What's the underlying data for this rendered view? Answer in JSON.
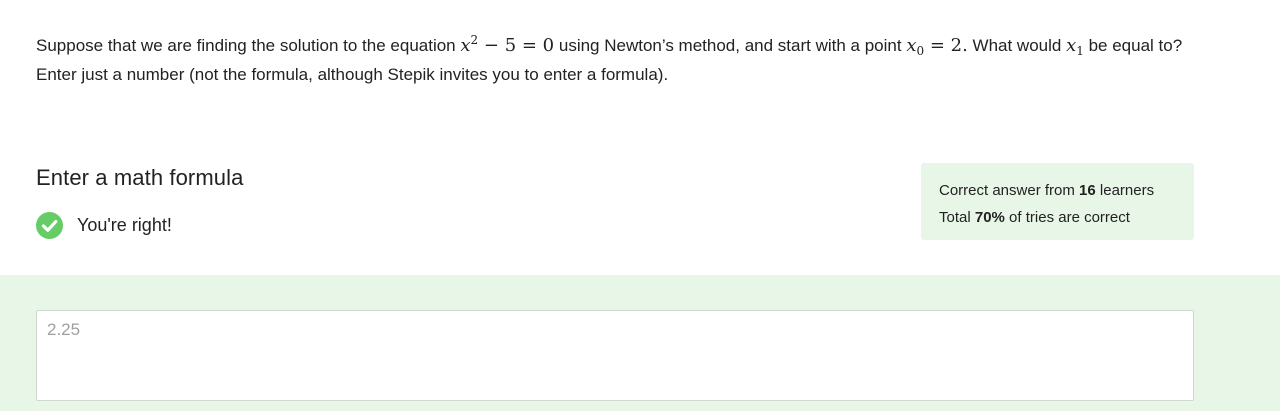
{
  "question": {
    "part1": "Suppose that we are finding the solution to the equation ",
    "eq_var": "x",
    "eq_exp": "2",
    "eq_rest": " − 5 = 0",
    "part2": " using Newton’s method, and start with a point ",
    "x0_var": "x",
    "x0_sub": "0",
    "x0_rest": " = 2.",
    "part3": " What would ",
    "x1_var": "x",
    "x1_sub": "1",
    "part4": " be equal to? Enter just a number (not the formula, although Stepik invites you to enter a formula)."
  },
  "section": {
    "title": "Enter a math formula"
  },
  "status": {
    "icon": "check-circle-icon",
    "text": "You're right!",
    "color": "#66cc66"
  },
  "stats": {
    "line1_prefix": "Correct answer from ",
    "learners": "16",
    "line1_suffix": " learners",
    "line2_prefix": "Total ",
    "percent": "70%",
    "line2_suffix": " of tries are correct"
  },
  "answer": {
    "value": "2.25"
  },
  "colors": {
    "success_bg": "#e8f6e8",
    "success_icon": "#66cc66"
  }
}
